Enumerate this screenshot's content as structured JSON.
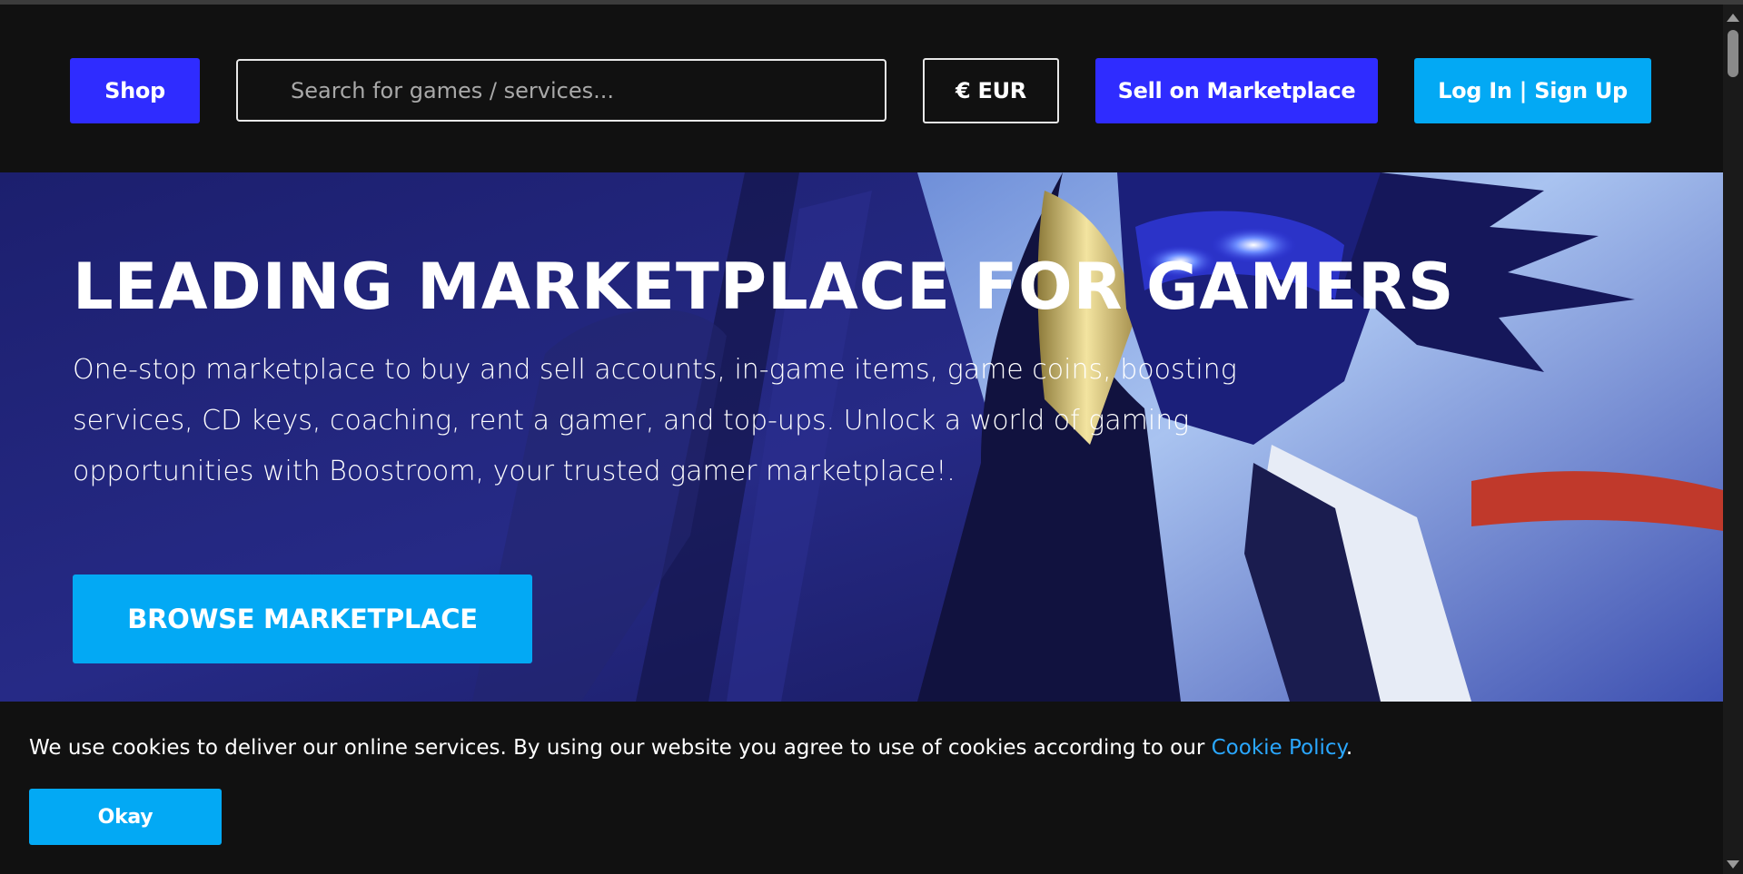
{
  "header": {
    "shop_label": "Shop",
    "search_placeholder": "Search for games / services...",
    "currency_label": "€ EUR",
    "sell_label": "Sell on Marketplace",
    "login_label": "Log In | Sign Up"
  },
  "hero": {
    "title": "LEADING MARKETPLACE FOR GAMERS",
    "description": "One-stop marketplace to buy and sell accounts, in-game items, game coins, boosting services, CD keys, coaching, rent a gamer, and top-ups. Unlock a world of gaming opportunities with Boostroom, your trusted gamer marketplace!.",
    "browse_label": "BROWSE MARKETPLACE"
  },
  "cookie_banner": {
    "text": "We use cookies to deliver our online services. By using our website you agree to use of cookies according to our ",
    "link_label": "Cookie Policy",
    "trailing": ".",
    "okay_label": "Okay"
  },
  "colors": {
    "brand_blue": "#2f2cff",
    "accent_cyan": "#03a9f4",
    "background": "#111111",
    "link": "#2aa7ff"
  },
  "icons": {
    "hero_art": "masked-warrior-illustration"
  }
}
